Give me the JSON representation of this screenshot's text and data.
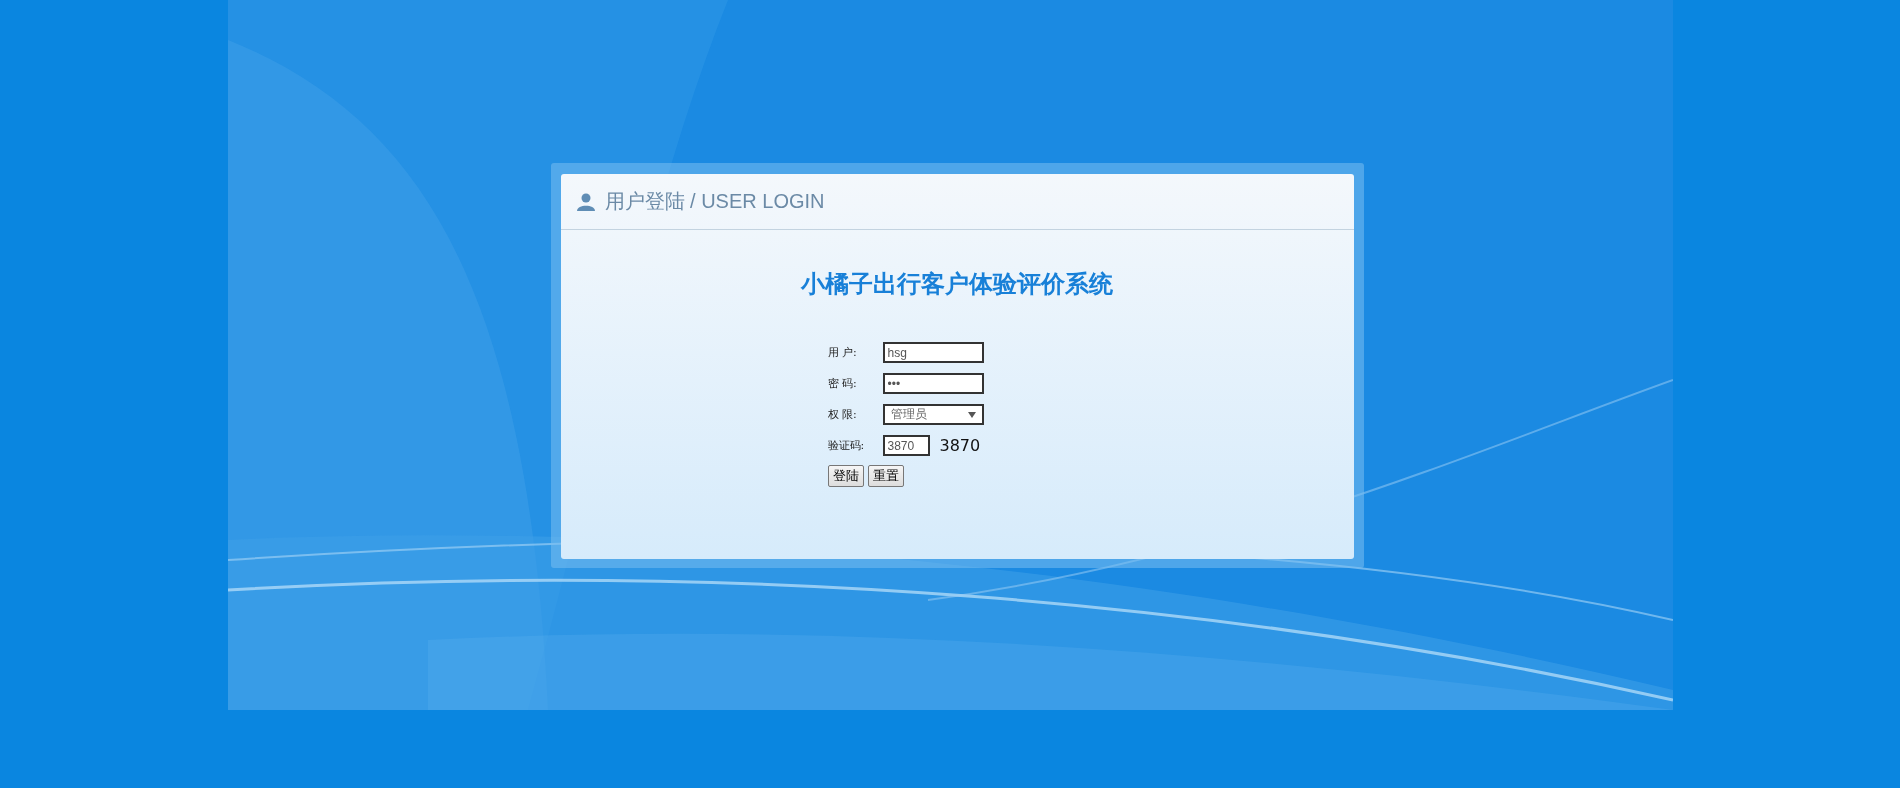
{
  "panel": {
    "header": "用户登陆 / USER LOGIN"
  },
  "title": "小橘子出行客户体验评价系统",
  "form": {
    "fields": [
      {
        "kind": "text",
        "label": "用 户:",
        "value": "hsg"
      },
      {
        "kind": "text",
        "label": "密 码:",
        "value": "•••"
      },
      {
        "kind": "select",
        "label": "权 限:",
        "value": "管理员"
      },
      {
        "kind": "captcha",
        "label": "验证码:",
        "value": "3870",
        "code": "3870"
      }
    ],
    "buttons": [
      "登陆",
      "重置"
    ]
  }
}
